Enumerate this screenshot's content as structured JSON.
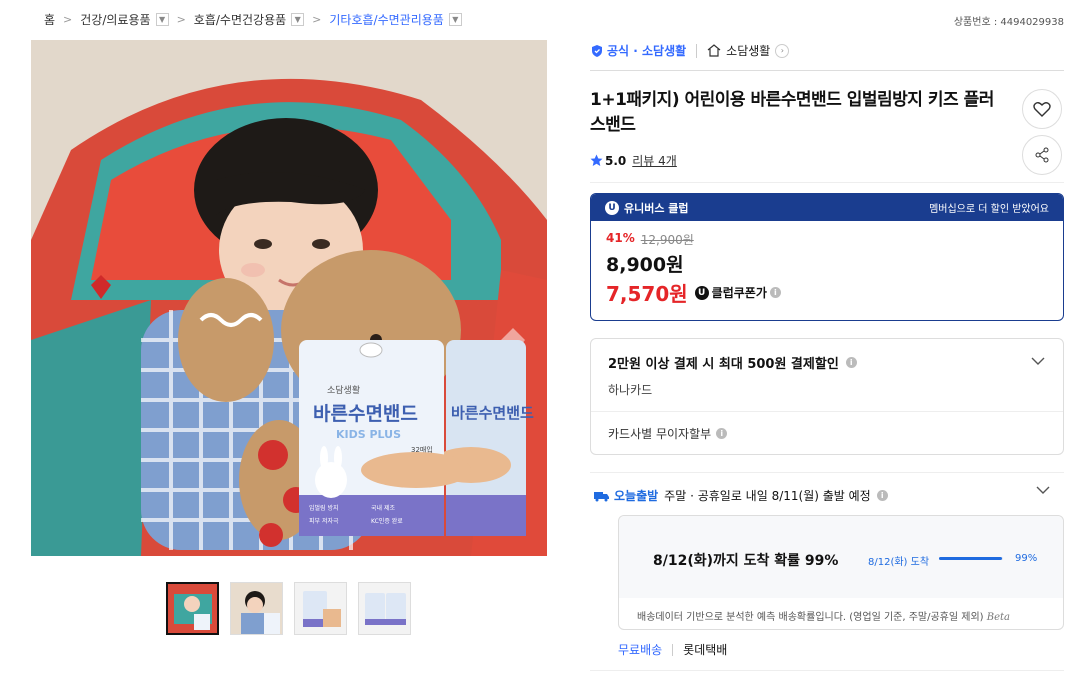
{
  "breadcrumb": {
    "items": [
      "홈",
      "건강/의료용품",
      "호흡/수면건강용품",
      "기타호흡/수면관리용품"
    ],
    "separator": ">"
  },
  "product_number": "상품번호 : 4494029938",
  "gallery": {
    "main_image_alt": "child with pillow and tape package",
    "package": {
      "brand": "소담생활",
      "name": "바른수면밴드",
      "sub": "KIDS PLUS",
      "count": "32매입",
      "feature1": "입벌림 방지",
      "feature2": "국내 제조",
      "feature3": "피부 저자극",
      "feature4": "KC인증 완료"
    }
  },
  "brand": {
    "official_label": "공식 · 소담생활",
    "store_name": "소담생활"
  },
  "title": "1+1패키지) 어린이용 바른수면밴드 입벌림방지 키즈 플러스밴드",
  "rating": {
    "score": "5.0",
    "reviews": "리뷰 4개"
  },
  "club": {
    "badge": "U",
    "name": "유니버스 클럽",
    "promo": "멤버십으로 더 할인 받았어요",
    "discount_rate": "41%",
    "original_price": "12,900원",
    "price": "8,900원",
    "coupon_price": "7,570원",
    "coupon_label": "클럽쿠폰가"
  },
  "payment": {
    "title": "2만원 이상 결제 시 최대 500원 결제할인",
    "card": "하나카드",
    "installment": "카드사별 무이자할부"
  },
  "delivery": {
    "badge": "오늘출발",
    "text": "주말 · 공휴일로 내일 8/11(월) 출발 예정",
    "probability_text": "8/12(화)까지 도착 확률 99%",
    "arrival_label": "8/12(화) 도착",
    "percent_label": "99%",
    "percent_value": 99,
    "note": "배송데이터 기반으로 분석한 예측 배송확률입니다. (영업일 기준, 주말/공휴일 제외)",
    "beta": "Beta",
    "shipping_fee": "무료배송",
    "carrier": "롯데택배"
  },
  "colors": {
    "accent_blue": "#346aff",
    "club_navy": "#1a3d8f",
    "sale_red": "#e52528"
  },
  "icons": [
    "official-shield-icon",
    "store-home-icon",
    "heart-icon",
    "share-icon",
    "star-icon",
    "chevron-down-icon",
    "info-icon",
    "delivery-truck-icon"
  ]
}
